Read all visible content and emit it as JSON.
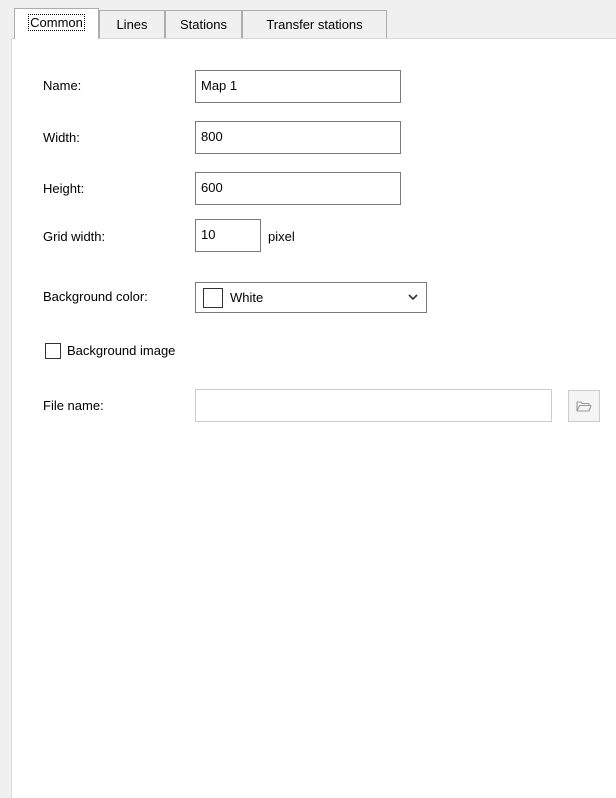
{
  "tabs": [
    {
      "label": "Common",
      "active": true
    },
    {
      "label": "Lines",
      "active": false
    },
    {
      "label": "Stations",
      "active": false
    },
    {
      "label": "Transfer stations",
      "active": false
    }
  ],
  "form": {
    "name_label": "Name:",
    "name_value": "Map 1",
    "width_label": "Width:",
    "width_value": "800",
    "height_label": "Height:",
    "height_value": "600",
    "grid_label": "Grid width:",
    "grid_value": "10",
    "grid_unit": "pixel",
    "bgcolor_label": "Background color:",
    "bgcolor_value": "White",
    "bgcolor_swatch": "#ffffff",
    "bgimage_label": "Background image",
    "bgimage_checked": false,
    "filename_label": "File name:",
    "filename_value": ""
  },
  "icons": {
    "dropdown": "chevron-down-icon",
    "browse": "folder-open-icon"
  }
}
